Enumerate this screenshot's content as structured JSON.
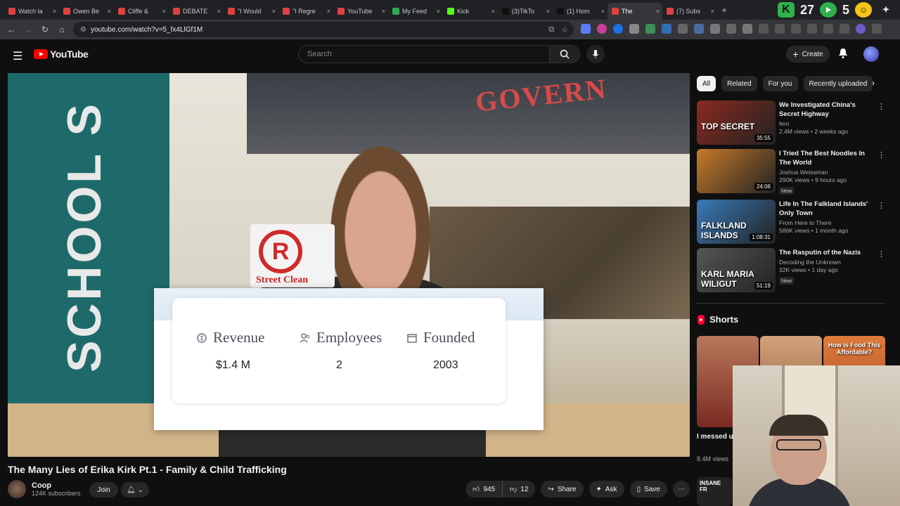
{
  "browser": {
    "tabs": [
      {
        "title": "Watch la",
        "color": "#e04040"
      },
      {
        "title": "Owen Be",
        "color": "#e04040"
      },
      {
        "title": "Cliffe &",
        "color": "#e04040"
      },
      {
        "title": "DEBATE",
        "color": "#e04040"
      },
      {
        "title": "\"I Would",
        "color": "#e04040"
      },
      {
        "title": "\"I Regre",
        "color": "#e04040"
      },
      {
        "title": "YouTube",
        "color": "#e04040"
      },
      {
        "title": "My Feed",
        "color": "#34a853"
      },
      {
        "title": "Kick",
        "color": "#53fc18"
      },
      {
        "title": "(3)TikTo",
        "color": "#111111"
      },
      {
        "title": "(1) Hom",
        "color": "#111111"
      },
      {
        "title": "The",
        "color": "#e04040"
      },
      {
        "title": "(7) Subs",
        "color": "#e04040"
      }
    ],
    "url": "youtube.com/watch?v=5_fx4LlGf1M",
    "top_counters": {
      "a": "27",
      "b": "5"
    },
    "gemini_label": "Gemini"
  },
  "masthead": {
    "logo_text": "YouTube",
    "search_placeholder": "Search",
    "create_label": "Create"
  },
  "video": {
    "title": "The Many Lies of Erika Kirk Pt.1 - Family & Child Trafficking",
    "channel": "Coop",
    "subscribers": "124K subscribers",
    "join_label": "Join",
    "likes": "945",
    "dislikes": "12",
    "share_label": "Share",
    "ask_label": "Ask",
    "save_label": "Save"
  },
  "overlay_card": {
    "stats": [
      {
        "label": "Revenue",
        "value": "$1.4 M"
      },
      {
        "label": "Employees",
        "value": "2"
      },
      {
        "label": "Founded",
        "value": "2003"
      }
    ]
  },
  "scene": {
    "banner_text": "GOVERN",
    "sign_text": "SCHOOL S",
    "logo_letter": "R",
    "logo_caption": "Street Clean"
  },
  "sidebar": {
    "chips": [
      "All",
      "Related",
      "For you",
      "Recently uploaded"
    ],
    "recommendations": [
      {
        "title": "We Investigated China's Secret Highway",
        "channel": "fern",
        "views": "2.4M views • 2 weeks ago",
        "duration": "35:55",
        "overlay": "TOP SECRET",
        "thumb": "#8b2a20",
        "new": ""
      },
      {
        "title": "I Tried The Best Noodles In The World",
        "channel": "Joshua Weissman",
        "views": "290K views • 9 hours ago",
        "duration": "24:06",
        "overlay": "",
        "thumb": "#c77a2a",
        "new": "New"
      },
      {
        "title": "Life In The Falkland Islands' Only Town",
        "channel": "From Here to There",
        "views": "586K views • 1 month ago",
        "duration": "1:08:31",
        "overlay": "FALKLAND ISLANDS",
        "thumb": "#3a7ab8",
        "new": ""
      },
      {
        "title": "The Rasputin of the Nazis",
        "channel": "Decoding the Unknown",
        "views": "32K views • 1 day ago",
        "duration": "51:19",
        "overlay": "KARL MARIA WILIGUT",
        "thumb": "#555555",
        "new": "New"
      }
    ],
    "shorts_heading": "Shorts",
    "short_title": "I messed u",
    "short_views": "8.4M views",
    "short_overlay": "How is Food This Affordable?",
    "insane_label": "INSANE FR"
  }
}
